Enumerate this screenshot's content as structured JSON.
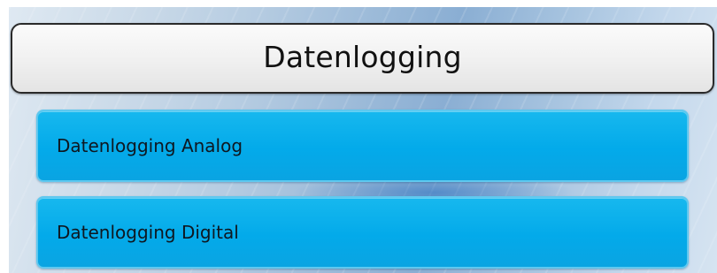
{
  "header": {
    "title": "Datenlogging"
  },
  "menu": {
    "items": [
      {
        "label": "Datenlogging Analog"
      },
      {
        "label": "Datenlogging Digital"
      }
    ]
  },
  "colors": {
    "button_fill": "#03aaea",
    "button_border": "#5fc8ef",
    "title_border": "#2a2a2a"
  }
}
